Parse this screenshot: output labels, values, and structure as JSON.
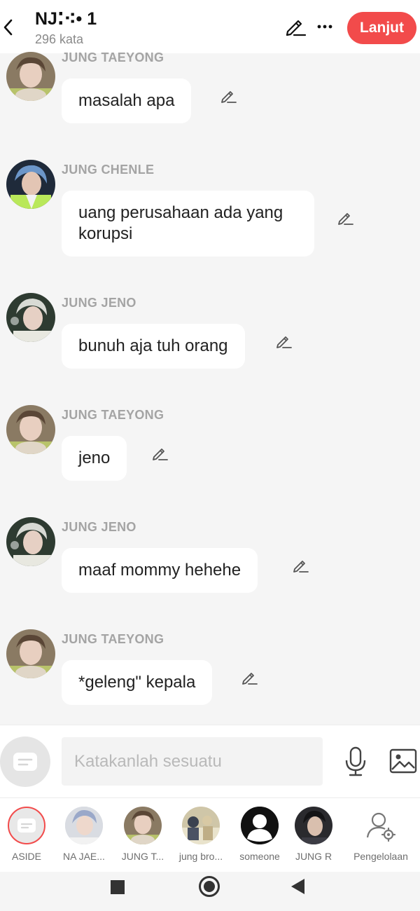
{
  "header": {
    "title": "NJ⁚⁖• 1",
    "subtitle": "296 kata",
    "continue_label": "Lanjut"
  },
  "messages": [
    {
      "name": "JUNG TAEYONG",
      "text": "masalah apa"
    },
    {
      "name": "JUNG CHENLE",
      "text": "uang perusahaan ada yang korupsi"
    },
    {
      "name": "JUNG JENO",
      "text": "bunuh aja tuh orang"
    },
    {
      "name": "JUNG TAEYONG",
      "text": "jeno"
    },
    {
      "name": "JUNG JENO",
      "text": "maaf mommy hehehe"
    },
    {
      "name": "JUNG TAEYONG",
      "text": "*geleng\" kepala"
    }
  ],
  "composer": {
    "placeholder": "Katakanlah sesuatu"
  },
  "characters": [
    {
      "label": "ASIDE"
    },
    {
      "label": "NA JAE..."
    },
    {
      "label": "JUNG T..."
    },
    {
      "label": "jung bro..."
    },
    {
      "label": "someone"
    },
    {
      "label": "JUNG R"
    },
    {
      "label": "Pengelolaan"
    }
  ],
  "colors": {
    "accent": "#f24b4b",
    "background": "#f5f5f5",
    "bubble": "#ffffff",
    "name_text": "#a4a4a4"
  },
  "icons": {
    "back": "chevron-left-icon",
    "edit": "pencil-icon",
    "more": "more-dots-icon",
    "aside": "chat-bubble-icon",
    "mic": "microphone-icon",
    "image": "image-icon",
    "manage": "user-gear-icon"
  }
}
